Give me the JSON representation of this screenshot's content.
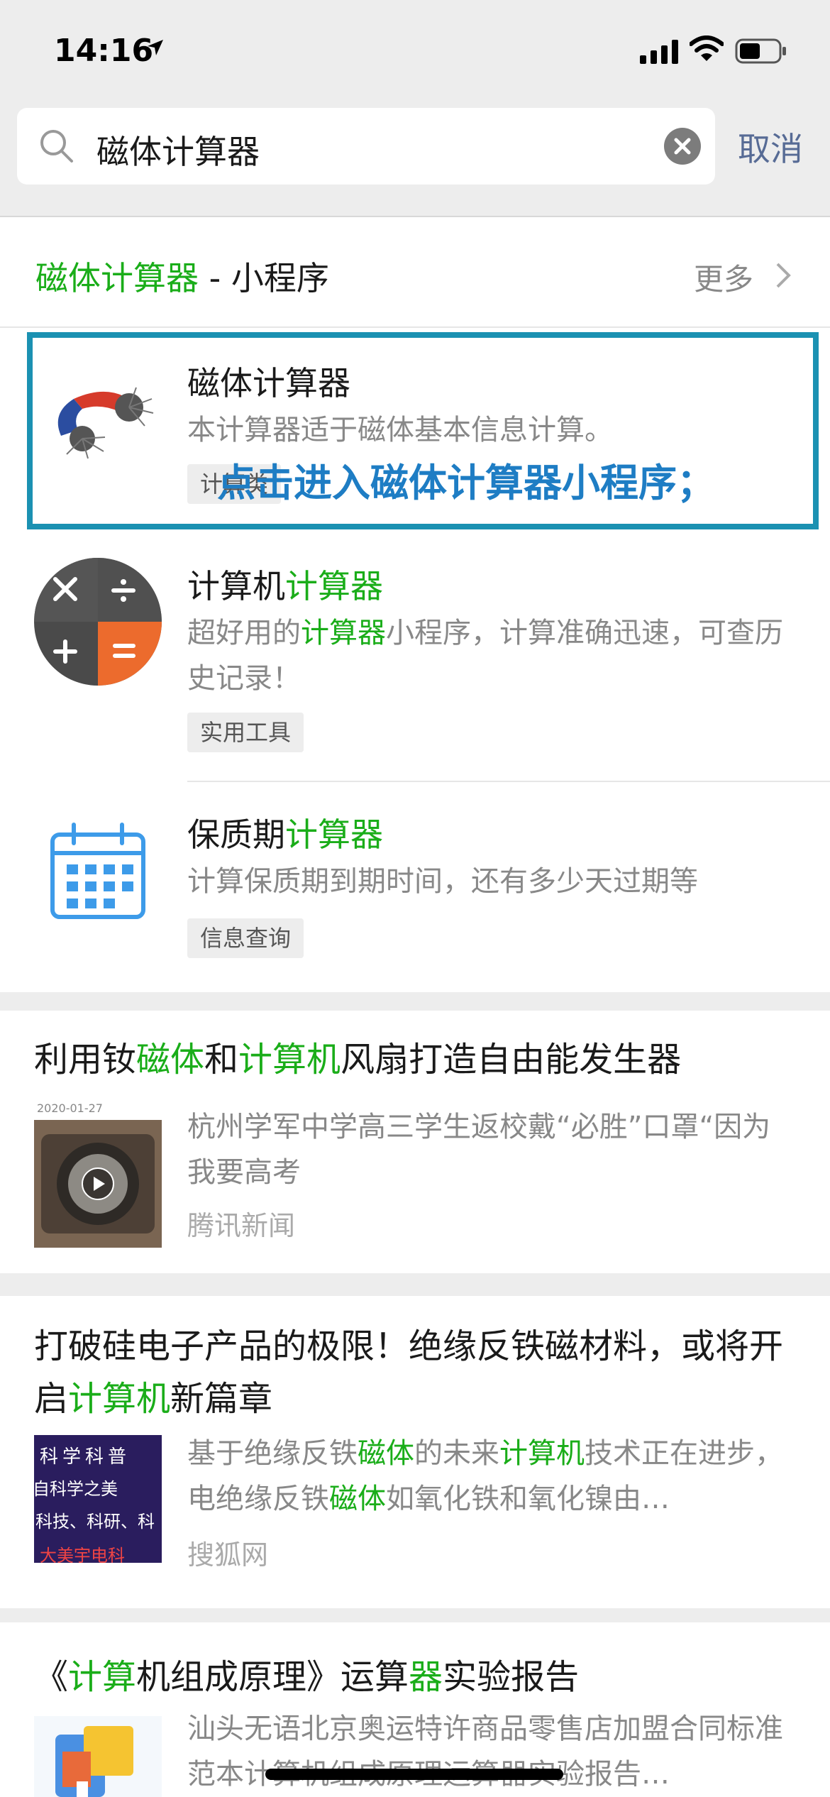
{
  "status": {
    "time": "14:16"
  },
  "search": {
    "query": "磁体计算器",
    "cancel": "取消"
  },
  "mini_section": {
    "title_green": "磁体计算器",
    "title_rest": " - 小程序",
    "more": "更多"
  },
  "mini_apps": [
    {
      "title": "磁体计算器",
      "desc": "本计算器适于磁体基本信息计算。",
      "tag": "计算类"
    },
    {
      "title_plain": "计算机",
      "title_green": "计算器",
      "desc_a": "超好用的",
      "desc_green": "计算器",
      "desc_b": "小程序，计算准确迅速，可查历史记录！",
      "tag": "实用工具"
    },
    {
      "title_plain": "保质期",
      "title_green": "计算器",
      "desc": "计算保质期到期时间，还有多少天过期等",
      "tag": "信息查询"
    }
  ],
  "annotation": "点击进入磁体计算器小程序；",
  "articles": [
    {
      "title_parts": [
        "利用钕",
        "磁体",
        "和",
        "计算机",
        "风扇打造自由能发生器"
      ],
      "date": "2020-01-27",
      "desc": "杭州学军中学高三学生返校戴“必胜”口罩“因为我要高考",
      "source": "腾讯新闻"
    },
    {
      "title_parts": [
        "打破硅电子产品的极限！绝缘反铁磁材料，或将开启",
        "计算机",
        "新篇章"
      ],
      "thumb_text": [
        "科学科普",
        "自科学之美",
        "科技、科研、科",
        "大美宇电科"
      ],
      "desc_parts": [
        "基于绝缘反铁",
        "磁体",
        "的未来",
        "计算机",
        "技术正在进步，电绝缘反铁",
        "磁体",
        "如氧化铁和氧化镍由…"
      ],
      "source": "搜狐网"
    },
    {
      "title_parts": [
        "《",
        "计算",
        "机组成原理》运算",
        "器",
        "实验报告"
      ],
      "desc": "汕头无语北京奥运特许商品零售店加盟合同标准范本计算机组成原理运算器实验报告…"
    }
  ],
  "colors": {
    "green": "#1aad19",
    "link": "#576b95",
    "box": "#1b91b2",
    "annotation": "#1e7dc4"
  }
}
